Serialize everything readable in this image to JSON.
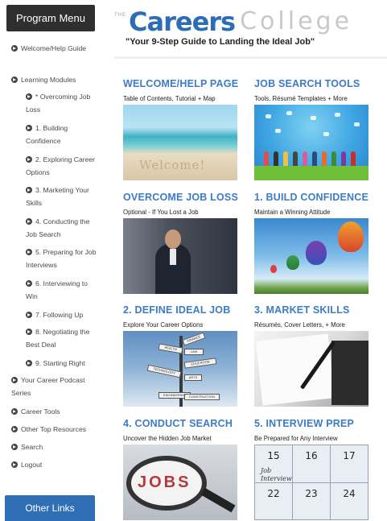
{
  "sidebar": {
    "header": "Program Menu",
    "items": [
      {
        "label": "Welcome/Help Guide"
      },
      {
        "label": "Learning Modules"
      },
      {
        "label": "* Overcoming Job Loss"
      },
      {
        "label": "1. Building Confidence"
      },
      {
        "label": "2. Exploring Career Options"
      },
      {
        "label": "3. Marketing Your Skills"
      },
      {
        "label": "4. Conducting the Job Search"
      },
      {
        "label": "5. Preparing for Job Interviews"
      },
      {
        "label": "6. Interviewing to Win"
      },
      {
        "label": "7. Following Up"
      },
      {
        "label": "8. Negotiating the Best Deal"
      },
      {
        "label": "9. Starting Right"
      },
      {
        "label": "Your Career Podcast Series"
      },
      {
        "label": "Career Tools"
      },
      {
        "label": "Other Top Resources"
      },
      {
        "label": "Search"
      },
      {
        "label": "Logout"
      }
    ],
    "other_links": "Other Links"
  },
  "header": {
    "logo_the": "THE",
    "logo_careers": "Careers",
    "logo_college": "College",
    "tagline": "\"Your 9-Step Guide to Landing the Ideal Job\""
  },
  "cards": [
    {
      "title": "WELCOME/HELP PAGE",
      "subtitle": "Table of Contents, Tutorial + Map",
      "image": "welcome-beach",
      "image_text": "Welcome!"
    },
    {
      "title": "JOB SEARCH TOOLS",
      "subtitle": "Tools, Résumé Templates + More",
      "image": "people-icons"
    },
    {
      "title": "OVERCOME JOB LOSS",
      "subtitle": "Optional - If You Lost a Job",
      "image": "businessman"
    },
    {
      "title": "1. BUILD CONFIDENCE",
      "subtitle": "Maintain a Winning Attitude",
      "image": "hot-air-balloons"
    },
    {
      "title": "2. DEFINE IDEAL JOB",
      "subtitle": "Explore Your Career Options",
      "image": "signpost"
    },
    {
      "title": "3. MARKET SKILLS",
      "subtitle": "Résumés, Cover Letters, + More",
      "image": "pen-on-paper"
    },
    {
      "title": "4. CONDUCT SEARCH",
      "subtitle": "Uncover the Hidden Job Market",
      "image": "magnifier-jobs",
      "image_text": "JOBS"
    },
    {
      "title": "5. INTERVIEW PREP",
      "subtitle": "Be Prepared for Any Interview",
      "image": "calendar",
      "calendar": {
        "row1": [
          "15",
          "16",
          "17"
        ],
        "row2": [
          "22",
          "23",
          "24"
        ],
        "note": "Job Interview"
      }
    }
  ],
  "signpost_labels": [
    "FINANCE",
    "HEALTH",
    "LAW",
    "EDUCATION",
    "TECHNOLOGY",
    "ARTS",
    "ENGINEERING",
    "CONSTRUCTION"
  ],
  "colors": {
    "accent": "#3b7bc8",
    "menu_header": "#2f2f2f",
    "other_links": "#2f6fb6"
  }
}
